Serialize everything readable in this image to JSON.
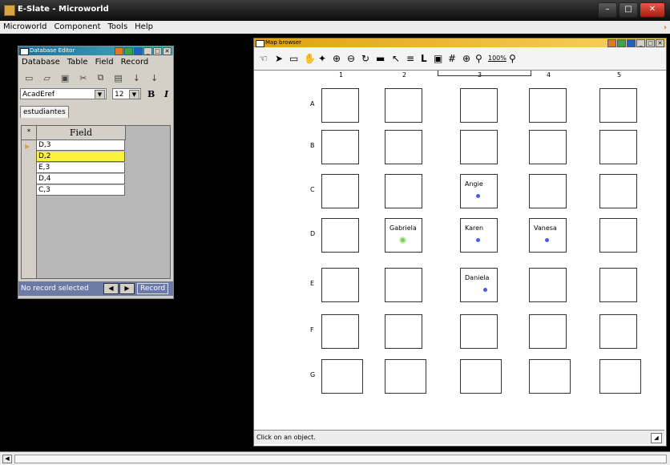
{
  "app": {
    "title": "E-Slate - Microworld"
  },
  "menubar": [
    "Microworld",
    "Component",
    "Tools",
    "Help"
  ],
  "db_editor": {
    "title": "Database Editor",
    "menu": [
      "Database",
      "Table",
      "Field",
      "Record"
    ],
    "font_name": "AcadEref",
    "font_size": "12",
    "bold_label": "B",
    "italic_label": "I",
    "tab": "estudiantes",
    "column_header": "Field",
    "star": "*",
    "rows": [
      "D,3",
      "D,2",
      "E,3",
      "D,4",
      "C,3"
    ],
    "selected_row": 1,
    "status": "No record selected",
    "record_label": "Record"
  },
  "map_browser": {
    "title": "Map browser",
    "zoom_label": "100%",
    "columns": [
      "1",
      "2",
      "3",
      "4",
      "5"
    ],
    "rows": [
      "A",
      "B",
      "C",
      "D",
      "E",
      "F",
      "G"
    ],
    "students": [
      {
        "cell": "C3",
        "name": "Angie"
      },
      {
        "cell": "D2",
        "name": "Gabriela"
      },
      {
        "cell": "D3",
        "name": "Karen"
      },
      {
        "cell": "D4",
        "name": "Vanesa"
      },
      {
        "cell": "E3",
        "name": "Daniela"
      }
    ],
    "status": "Click on an object."
  }
}
